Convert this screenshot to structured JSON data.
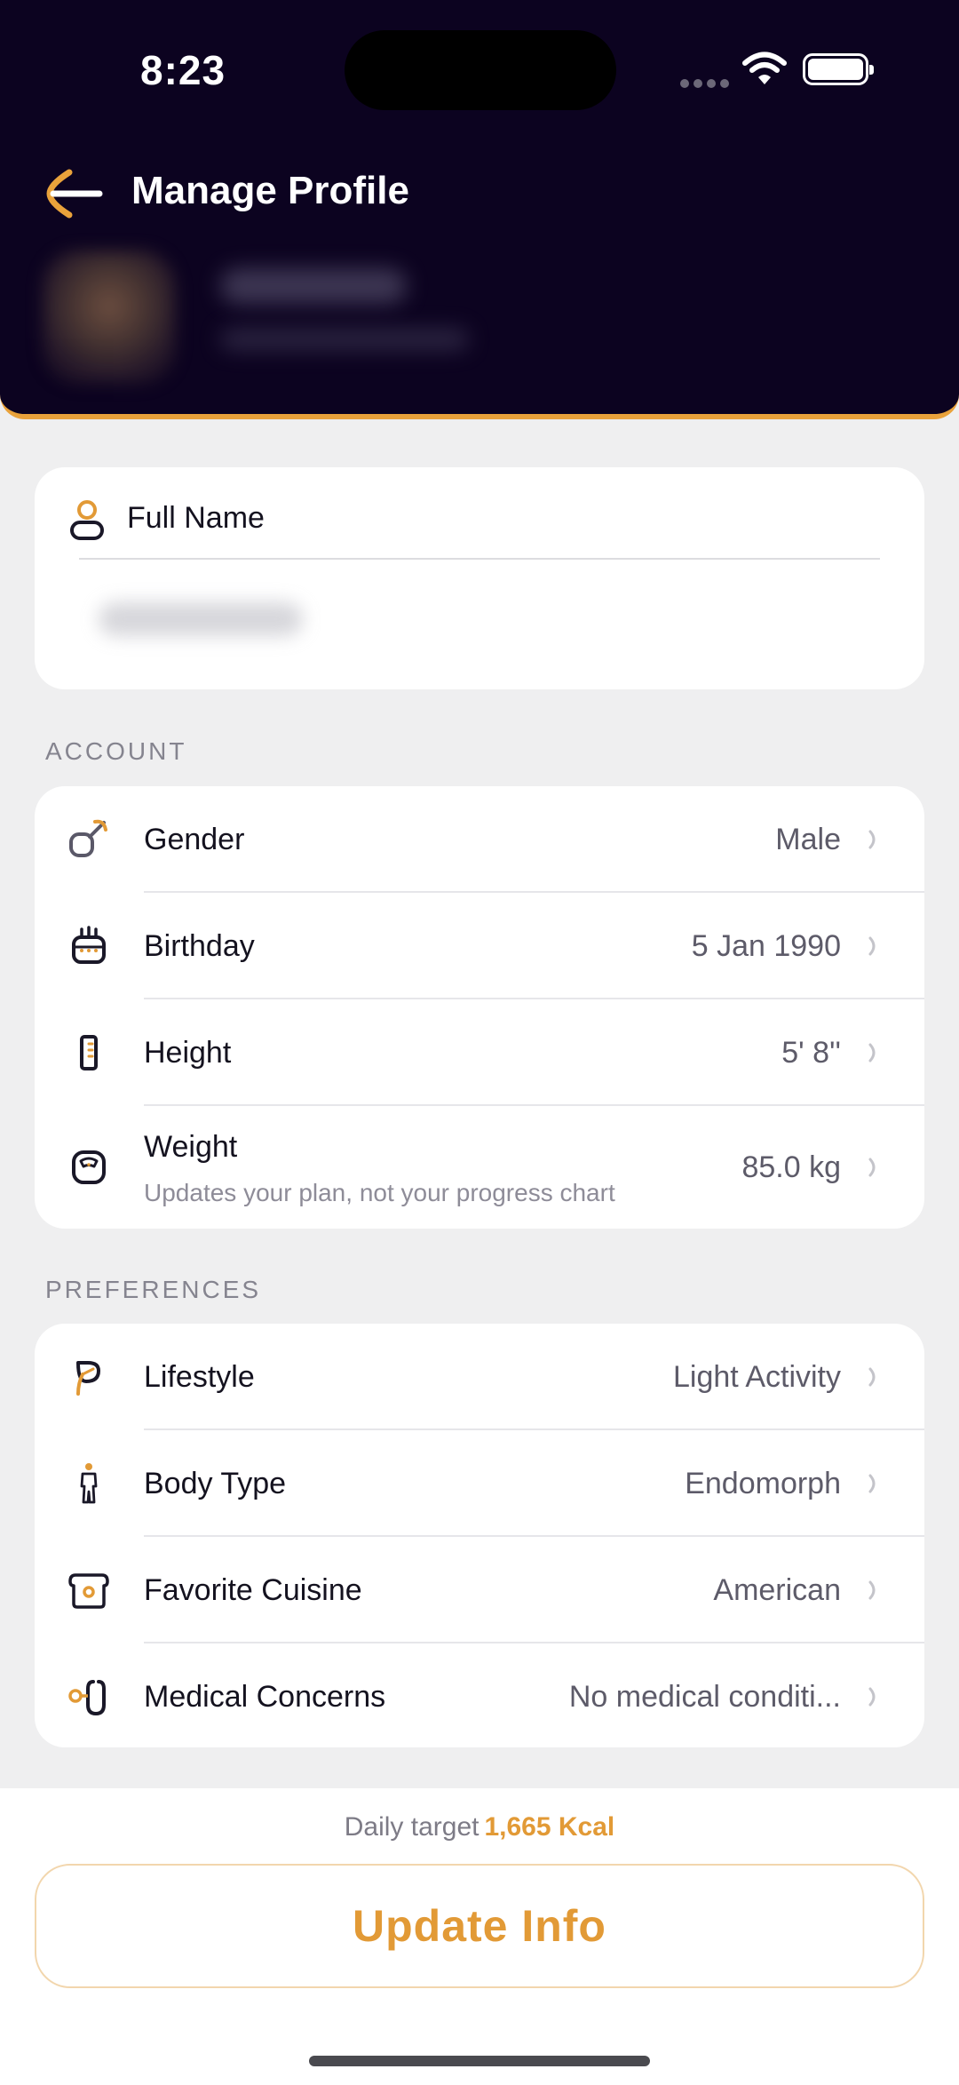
{
  "status_bar": {
    "time": "8:23"
  },
  "header": {
    "title": "Manage Profile"
  },
  "full_name": {
    "label": "Full Name"
  },
  "account": {
    "section_label": "ACCOUNT",
    "rows": [
      {
        "label": "Gender",
        "value": "Male",
        "icon": "gender-male-icon"
      },
      {
        "label": "Birthday",
        "value": "5 Jan 1990",
        "icon": "cake-icon"
      },
      {
        "label": "Height",
        "value": "5' 8''",
        "icon": "ruler-icon"
      },
      {
        "label": "Weight",
        "sublabel": "Updates your plan, not your progress chart",
        "value": "85.0 kg",
        "icon": "scale-icon"
      }
    ]
  },
  "preferences": {
    "section_label": "PREFERENCES",
    "rows": [
      {
        "label": "Lifestyle",
        "value": "Light Activity",
        "icon": "leaf-icon"
      },
      {
        "label": "Body Type",
        "value": "Endomorph",
        "icon": "body-icon"
      },
      {
        "label": "Favorite Cuisine",
        "value": "American",
        "icon": "bread-icon"
      },
      {
        "label": "Medical Concerns",
        "value": "No medical conditi...",
        "icon": "stethoscope-icon"
      }
    ]
  },
  "footer": {
    "daily_target_label": "Daily target",
    "daily_target_value": "1,665 Kcal",
    "update_button": "Update Info"
  },
  "colors": {
    "header_bg": "#0c0320",
    "accent": "#e29a36",
    "page_bg": "#efeff0"
  }
}
